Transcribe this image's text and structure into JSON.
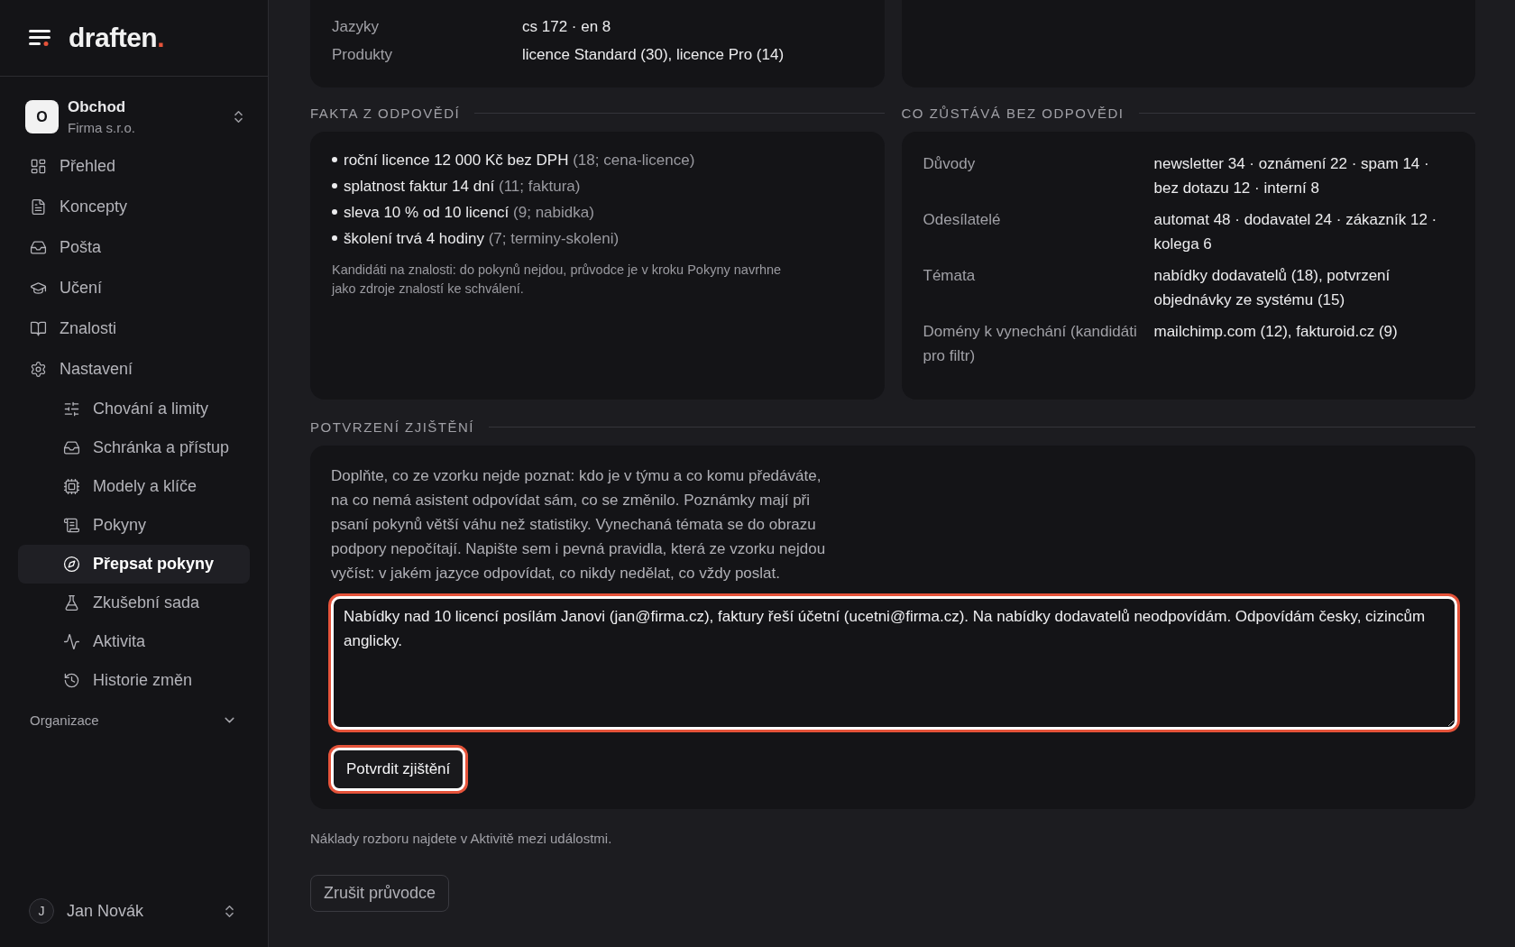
{
  "sidebar": {
    "logo": {
      "text": "draften",
      "accent": "."
    },
    "workspace": {
      "initial": "O",
      "name": "Obchod",
      "company": "Firma s.r.o."
    },
    "items": [
      {
        "label": "Přehled",
        "selected": false
      },
      {
        "label": "Koncepty",
        "selected": false
      },
      {
        "label": "Pošta",
        "selected": false
      },
      {
        "label": "Učení",
        "selected": false
      },
      {
        "label": "Znalosti",
        "selected": false
      },
      {
        "label": "Nastavení",
        "selected": false,
        "children": [
          {
            "label": "Chování a limity",
            "selected": false
          },
          {
            "label": "Schránka a přístup",
            "selected": false
          },
          {
            "label": "Modely a klíče",
            "selected": false
          },
          {
            "label": "Pokyny",
            "selected": false
          },
          {
            "label": "Přepsat pokyny",
            "selected": true
          },
          {
            "label": "Zkušební sada",
            "selected": false
          },
          {
            "label": "Aktivita",
            "selected": false
          },
          {
            "label": "Historie změn",
            "selected": false
          }
        ]
      }
    ],
    "group": {
      "label": "Organizace",
      "expanded": false
    },
    "user": {
      "initial": "J",
      "name": "Jan Novák"
    }
  },
  "summary": {
    "rows": [
      {
        "label": "Jazyky",
        "value": "cs 172 · en 8"
      },
      {
        "label": "Produkty",
        "value": "licence Standard (30), licence Pro (14)"
      }
    ]
  },
  "facts": {
    "title": "FAKTA Z ODPOVĚDÍ",
    "items": [
      {
        "text": "roční licence 12 000 Kč bez DPH",
        "source": "(18; cena-licence)"
      },
      {
        "text": "splatnost faktur 14 dní",
        "source": "(11; faktura)"
      },
      {
        "text": "sleva 10 % od 10 licencí",
        "source": "(9; nabidka)"
      },
      {
        "text": "školení trvá 4 hodiny",
        "source": "(7; terminy-skoleni)"
      }
    ],
    "note": "Kandidáti na znalosti: do pokynů nejdou, průvodce je v kroku Pokyny navrhne jako zdroje znalostí ke schválení."
  },
  "unanswered": {
    "title": "CO ZŮSTÁVÁ BEZ ODPOVĚDI",
    "rows": [
      {
        "label": "Důvody",
        "value": "newsletter 34 · oznámení 22 · spam 14 · bez dotazu 12 · interní 8"
      },
      {
        "label": "Odesílatelé",
        "value": "automat 48 · dodavatel 24 · zákazník 12 · kolega 6"
      },
      {
        "label": "Témata",
        "value": "nabídky dodavatelů (18), potvrzení objednávky ze systému (15)"
      },
      {
        "label": "Domény k vynechání (kandidáti pro filtr)",
        "value": "mailchimp.com (12), fakturoid.cz (9)"
      }
    ]
  },
  "confirm": {
    "title": "POTVRZENÍ ZJIŠTĚNÍ",
    "intro": "Doplňte, co ze vzorku nejde poznat: kdo je v týmu a co komu předáváte, na co nemá asistent odpovídat sám, co se změnilo. Poznámky mají při psaní pokynů větší váhu než statistiky. Vynechaná témata se do obrazu podpory nepočítají. Napište sem i pevná pravidla, která ze vzorku nejdou vyčíst: v jakém jazyce odpovídat, co nikdy nedělat, co vždy poslat.",
    "notes": {
      "value": "Nabídky nad 10 licencí posílám Janovi (jan@firma.cz), faktury řeší účetní (ucetni@firma.cz). Na nabídky dodavatelů neodpovídám. Odpovídám česky, cizincům anglicky.",
      "focused": true
    },
    "button": {
      "label": "Potvrdit zjištění",
      "focused": true
    }
  },
  "footnote": "Náklady rozboru najdete v Aktivitě mezi událostmi.",
  "cancel_button": "Zrušit průvodce"
}
